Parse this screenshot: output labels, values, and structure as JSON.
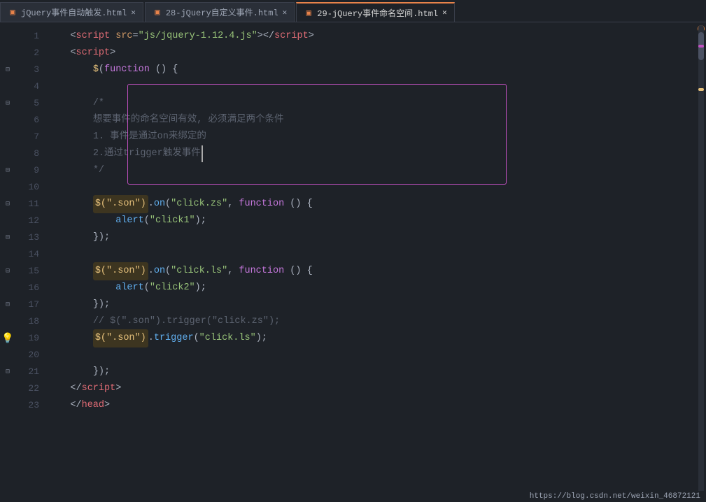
{
  "tabs": [
    {
      "label": "jQuery事件自动触发.html",
      "active": false,
      "icon": "html-icon"
    },
    {
      "label": "28-jQuery自定义事件.html",
      "active": false,
      "icon": "html-icon"
    },
    {
      "label": "29-jQuery事件命名空间.html",
      "active": true,
      "icon": "html-icon"
    }
  ],
  "code_lines": [
    {
      "num": 1,
      "content": "    <script src=\"js/jquery-1.12.4.js\"><\\/script>"
    },
    {
      "num": 2,
      "content": "    <script>"
    },
    {
      "num": 3,
      "content": "        $(function () {"
    },
    {
      "num": 4,
      "content": ""
    },
    {
      "num": 5,
      "content": "        /*"
    },
    {
      "num": 6,
      "content": "        想要事件的命名空间有效, 必须满足两个条件"
    },
    {
      "num": 7,
      "content": "        1. 事件是通过on来绑定的"
    },
    {
      "num": 8,
      "content": "        2.通过trigger触发事件"
    },
    {
      "num": 9,
      "content": "        */"
    },
    {
      "num": 10,
      "content": ""
    },
    {
      "num": 11,
      "content": "        $(\".son\").on(\"click.zs\", function () {"
    },
    {
      "num": 12,
      "content": "            alert(\"click1\");"
    },
    {
      "num": 13,
      "content": "        });"
    },
    {
      "num": 14,
      "content": ""
    },
    {
      "num": 15,
      "content": "        $(\".son\").on(\"click.ls\", function () {"
    },
    {
      "num": 16,
      "content": "            alert(\"click2\");"
    },
    {
      "num": 17,
      "content": "        });"
    },
    {
      "num": 18,
      "content": "        // $(\".son\").trigger(\"click.zs\");"
    },
    {
      "num": 19,
      "content": "        $(\".son\").trigger(\"click.ls\");"
    },
    {
      "num": 20,
      "content": ""
    },
    {
      "num": 21,
      "content": "        });"
    },
    {
      "num": 22,
      "content": "    <\\/script>"
    },
    {
      "num": 23,
      "content": "    <\\/head>"
    }
  ],
  "status_bar": {
    "url": "https://blog.csdn.net/weixin_46872121"
  },
  "comment_box": {
    "label": "comment-highlight-box"
  }
}
